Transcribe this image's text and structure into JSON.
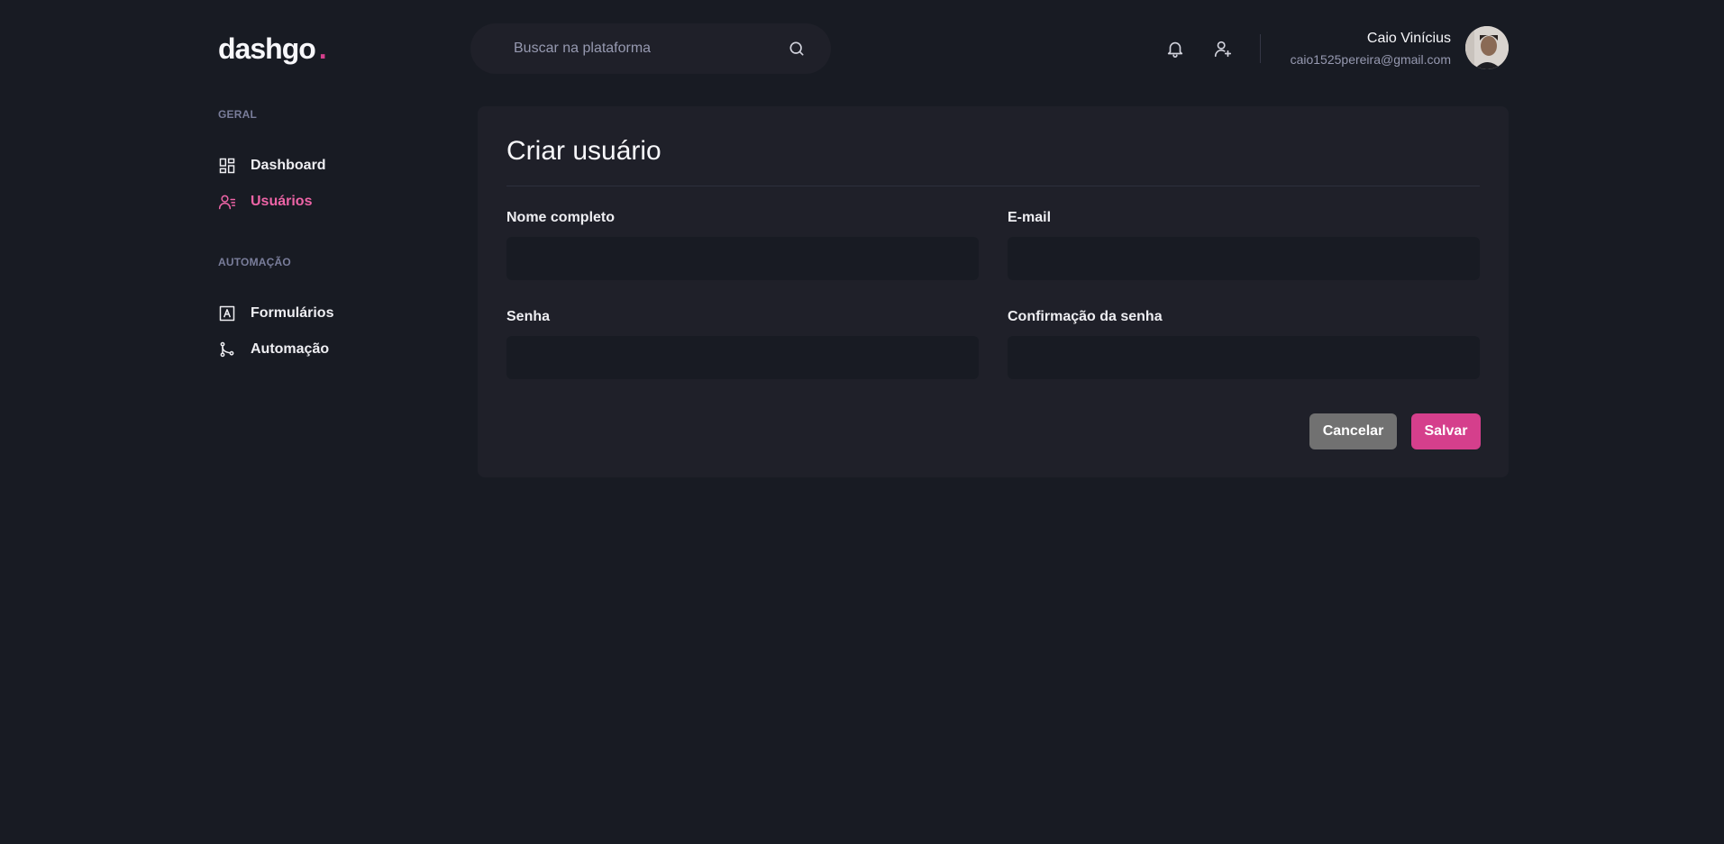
{
  "brand": {
    "name": "dashgo",
    "dot": "."
  },
  "search": {
    "placeholder": "Buscar na plataforma",
    "icon": "search-icon"
  },
  "header_icons": [
    "bell-icon",
    "user-add-icon"
  ],
  "profile": {
    "name": "Caio Vinícius",
    "email": "caio1525pereira@gmail.com"
  },
  "sidebar": {
    "sections": [
      {
        "title": "GERAL",
        "items": [
          {
            "label": "Dashboard",
            "icon": "dashboard-icon",
            "active": false
          },
          {
            "label": "Usuários",
            "icon": "users-icon",
            "active": true
          }
        ]
      },
      {
        "title": "AUTOMAÇÃO",
        "items": [
          {
            "label": "Formulários",
            "icon": "form-icon",
            "active": false
          },
          {
            "label": "Automação",
            "icon": "git-merge-icon",
            "active": false
          }
        ]
      }
    ]
  },
  "form": {
    "title": "Criar usuário",
    "fields": {
      "name": {
        "label": "Nome completo",
        "value": ""
      },
      "email": {
        "label": "E-mail",
        "value": ""
      },
      "password": {
        "label": "Senha",
        "value": ""
      },
      "password_confirmation": {
        "label": "Confirmação da senha",
        "value": ""
      }
    },
    "cancel_label": "Cancelar",
    "save_label": "Salvar"
  },
  "colors": {
    "background": "#181B23",
    "card": "#1F2029",
    "accent": "#D53F8C",
    "accent_light": "#ED64A6",
    "cancel_button": "#717171"
  }
}
